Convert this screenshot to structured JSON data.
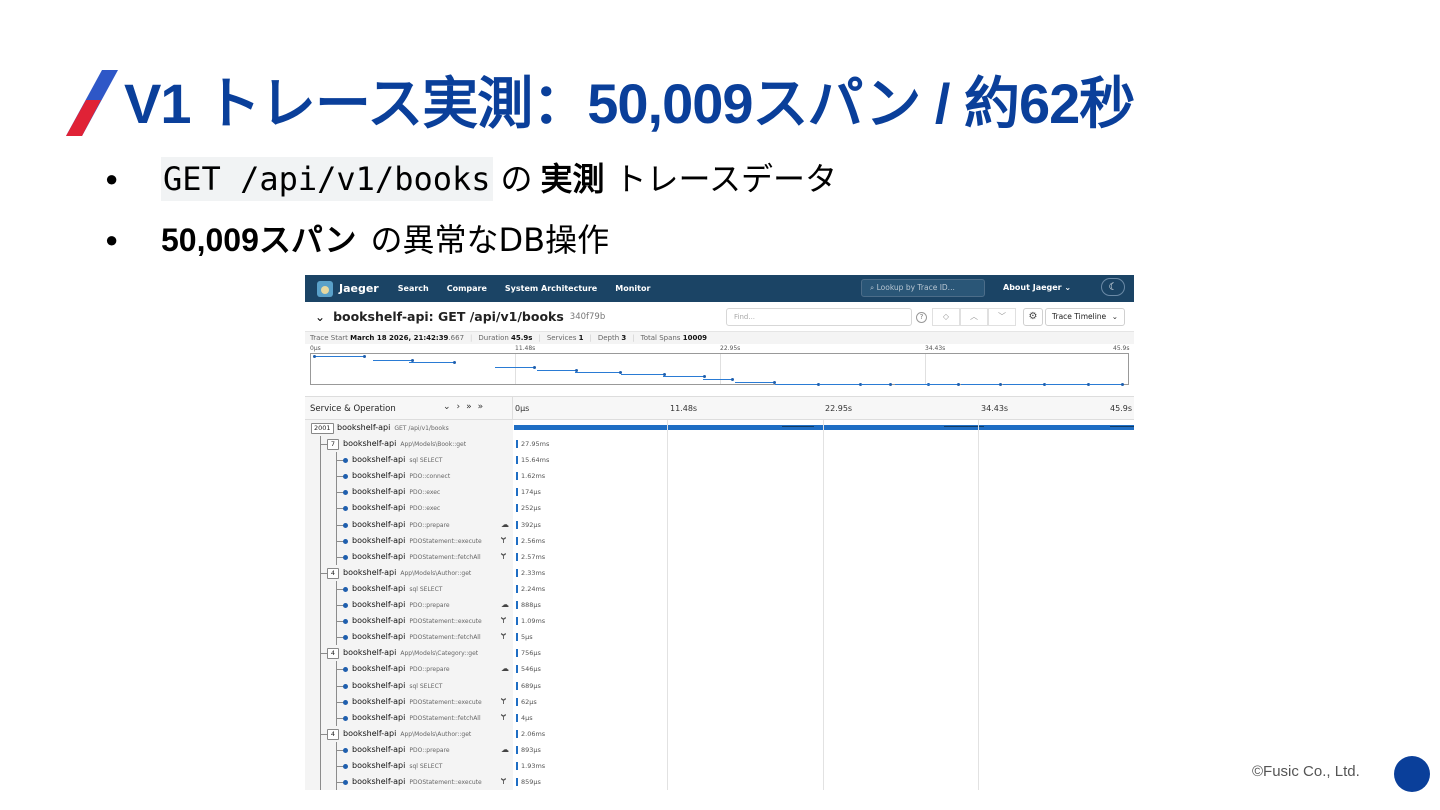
{
  "slide": {
    "title": "V1 トレース実測：50,009スパン / 約62秒",
    "bullets": [
      {
        "code": "GET /api/v1/books",
        "mid": "の",
        "strong": "実測",
        "rest": "トレースデータ"
      },
      {
        "strong": "50,009スパン",
        "rest": "の異常なDB操作"
      }
    ],
    "copyright": "©Fusic Co., Ltd.",
    "accent_color": "#0a3f9a",
    "slash_colors": [
      "#e02236",
      "#2e57c7"
    ]
  },
  "jaeger": {
    "brand": "Jaeger",
    "logo_icon": "jaeger-logo-icon",
    "nav": [
      "Search",
      "Compare",
      "System Architecture",
      "Monitor"
    ],
    "lookup_placeholder": "Lookup by Trace ID...",
    "about": "About Jaeger",
    "trace": {
      "title": "bookshelf-api: GET /api/v1/books",
      "id": "340f79b",
      "find_placeholder": "Find...",
      "view": "Trace Timeline",
      "meta": {
        "start_label": "Trace Start",
        "start_value": "March 18 2026, 21:42:39",
        "start_ms": ".667",
        "duration_label": "Duration",
        "duration_value": "45.9s",
        "services_label": "Services",
        "services_value": "1",
        "depth_label": "Depth",
        "depth_value": "3",
        "spans_label": "Total Spans",
        "spans_value": "10009"
      }
    },
    "ticks": [
      "0μs",
      "11.48s",
      "22.95s",
      "34.43s",
      "45.9s"
    ],
    "column_header": "Service & Operation",
    "rows": [
      {
        "level": 0,
        "badge": "2001",
        "service": "bookshelf-api",
        "op": "GET /api/v1/books",
        "duration": "",
        "flag": ""
      },
      {
        "level": 1,
        "badge": "7",
        "service": "bookshelf-api",
        "op": "App\\Models\\Book::get",
        "duration": "27.95ms",
        "flag": ""
      },
      {
        "level": 2,
        "badge": "",
        "service": "bookshelf-api",
        "op": "sql SELECT",
        "duration": "15.64ms",
        "flag": ""
      },
      {
        "level": 2,
        "badge": "",
        "service": "bookshelf-api",
        "op": "PDO::connect",
        "duration": "1.62ms",
        "flag": ""
      },
      {
        "level": 2,
        "badge": "",
        "service": "bookshelf-api",
        "op": "PDO::exec",
        "duration": "174μs",
        "flag": ""
      },
      {
        "level": 2,
        "badge": "",
        "service": "bookshelf-api",
        "op": "PDO::exec",
        "duration": "252μs",
        "flag": ""
      },
      {
        "level": 2,
        "badge": "",
        "service": "bookshelf-api",
        "op": "PDO::prepare",
        "duration": "392μs",
        "flag": "☁"
      },
      {
        "level": 2,
        "badge": "",
        "service": "bookshelf-api",
        "op": "PDOStatement::execute",
        "duration": "2.56ms",
        "flag": "Ɏ"
      },
      {
        "level": 2,
        "badge": "",
        "service": "bookshelf-api",
        "op": "PDOStatement::fetchAll",
        "duration": "2.57ms",
        "flag": "Ɏ"
      },
      {
        "level": 1,
        "badge": "4",
        "service": "bookshelf-api",
        "op": "App\\Models\\Author::get",
        "duration": "2.33ms",
        "flag": ""
      },
      {
        "level": 2,
        "badge": "",
        "service": "bookshelf-api",
        "op": "sql SELECT",
        "duration": "2.24ms",
        "flag": ""
      },
      {
        "level": 2,
        "badge": "",
        "service": "bookshelf-api",
        "op": "PDO::prepare",
        "duration": "888μs",
        "flag": "☁"
      },
      {
        "level": 2,
        "badge": "",
        "service": "bookshelf-api",
        "op": "PDOStatement::execute",
        "duration": "1.09ms",
        "flag": "Ɏ"
      },
      {
        "level": 2,
        "badge": "",
        "service": "bookshelf-api",
        "op": "PDOStatement::fetchAll",
        "duration": "5μs",
        "flag": "Ɏ"
      },
      {
        "level": 1,
        "badge": "4",
        "service": "bookshelf-api",
        "op": "App\\Models\\Category::get",
        "duration": "756μs",
        "flag": ""
      },
      {
        "level": 2,
        "badge": "",
        "service": "bookshelf-api",
        "op": "PDO::prepare",
        "duration": "546μs",
        "flag": "☁"
      },
      {
        "level": 2,
        "badge": "",
        "service": "bookshelf-api",
        "op": "sql SELECT",
        "duration": "689μs",
        "flag": ""
      },
      {
        "level": 2,
        "badge": "",
        "service": "bookshelf-api",
        "op": "PDOStatement::execute",
        "duration": "62μs",
        "flag": "Ɏ"
      },
      {
        "level": 2,
        "badge": "",
        "service": "bookshelf-api",
        "op": "PDOStatement::fetchAll",
        "duration": "4μs",
        "flag": "Ɏ"
      },
      {
        "level": 1,
        "badge": "4",
        "service": "bookshelf-api",
        "op": "App\\Models\\Author::get",
        "duration": "2.06ms",
        "flag": ""
      },
      {
        "level": 2,
        "badge": "",
        "service": "bookshelf-api",
        "op": "PDO::prepare",
        "duration": "893μs",
        "flag": "☁"
      },
      {
        "level": 2,
        "badge": "",
        "service": "bookshelf-api",
        "op": "sql SELECT",
        "duration": "1.93ms",
        "flag": ""
      },
      {
        "level": 2,
        "badge": "",
        "service": "bookshelf-api",
        "op": "PDOStatement::execute",
        "duration": "859μs",
        "flag": "Ɏ"
      }
    ],
    "bar_color": "#1f6ec4",
    "nav_color": "#1b4465"
  }
}
